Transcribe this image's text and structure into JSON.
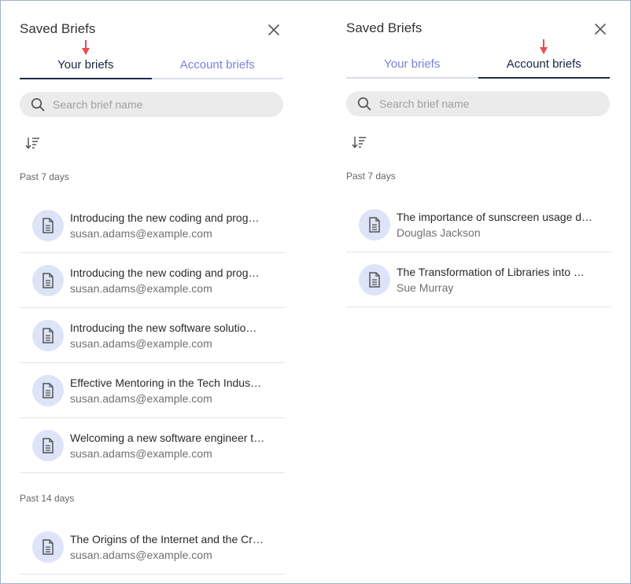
{
  "left_panel": {
    "title": "Saved Briefs",
    "tabs": [
      {
        "label": "Your briefs",
        "active": true
      },
      {
        "label": "Account briefs",
        "active": false
      }
    ],
    "search": {
      "placeholder": "Search brief name",
      "value": ""
    },
    "sections": [
      {
        "label": "Past 7 days",
        "items": [
          {
            "title": "Introducing the new coding and prog…",
            "subtitle": "susan.adams@example.com"
          },
          {
            "title": "Introducing the new coding and prog…",
            "subtitle": "susan.adams@example.com"
          },
          {
            "title": "Introducing the new software solutio…",
            "subtitle": "susan.adams@example.com"
          },
          {
            "title": "Effective Mentoring in the Tech Indus…",
            "subtitle": "susan.adams@example.com"
          },
          {
            "title": "Welcoming a new software engineer t…",
            "subtitle": "susan.adams@example.com"
          }
        ]
      },
      {
        "label": "Past 14 days",
        "items": [
          {
            "title": "The Origins of the Internet and the Cr…",
            "subtitle": "susan.adams@example.com"
          }
        ]
      }
    ]
  },
  "right_panel": {
    "title": "Saved Briefs",
    "tabs": [
      {
        "label": "Your briefs",
        "active": false
      },
      {
        "label": "Account briefs",
        "active": true
      }
    ],
    "search": {
      "placeholder": "Search brief name",
      "value": ""
    },
    "sections": [
      {
        "label": "Past 7 days",
        "items": [
          {
            "title": "The importance of sunscreen usage d…",
            "subtitle": "Douglas Jackson"
          },
          {
            "title": "The Transformation of Libraries into …",
            "subtitle": "Sue Murray"
          }
        ]
      }
    ]
  },
  "icons": {
    "close": "close-icon",
    "search": "search-icon",
    "sort": "sort-descending-icon",
    "document": "document-icon",
    "marker": "down-arrow-marker-icon"
  },
  "colors": {
    "tab_active": "#1f2a4a",
    "tab_inactive": "#7b7fe0",
    "marker": "#f04a4a",
    "doc_circle": "#dde4f7",
    "search_bg": "#ebebeb"
  }
}
